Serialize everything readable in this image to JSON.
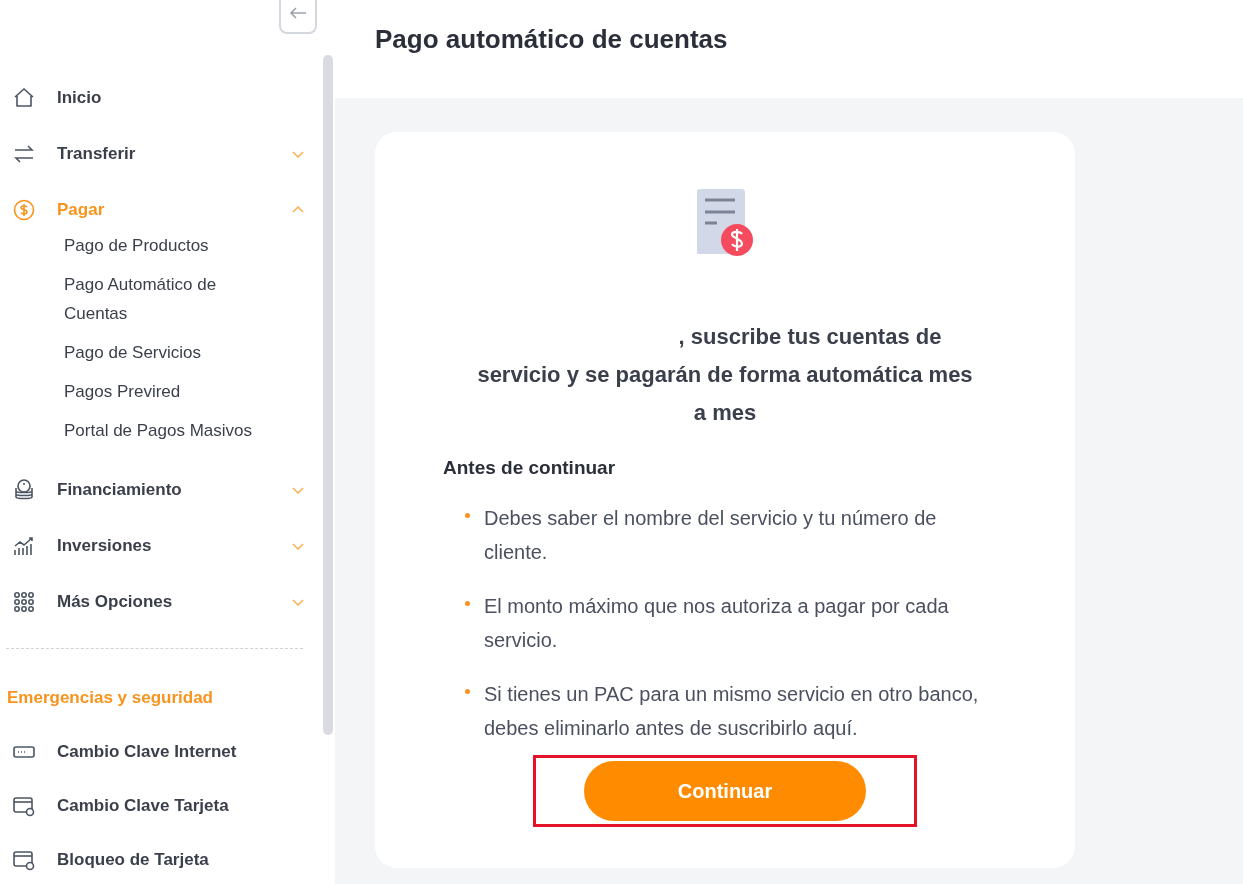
{
  "page": {
    "title": "Pago automático de cuentas"
  },
  "sidebar": {
    "items": [
      {
        "kind": "link",
        "label": "Inicio",
        "selected": false
      },
      {
        "kind": "group",
        "label": "Transferir",
        "expanded": false,
        "selected": false
      },
      {
        "kind": "group",
        "label": "Pagar",
        "expanded": true,
        "selected": true,
        "children": [
          {
            "label": "Pago de Productos"
          },
          {
            "label": "Pago Automático de Cuentas"
          },
          {
            "label": "Pago de Servicios"
          },
          {
            "label": "Pagos Previred"
          },
          {
            "label": "Portal de Pagos Masivos"
          }
        ]
      },
      {
        "kind": "group",
        "label": "Financiamiento",
        "expanded": false,
        "selected": false
      },
      {
        "kind": "group",
        "label": "Inversiones",
        "expanded": false,
        "selected": false
      },
      {
        "kind": "group",
        "label": "Más Opciones",
        "expanded": false,
        "selected": false
      }
    ],
    "section_title": "Emergencias y seguridad",
    "security_items": [
      {
        "label": "Cambio Clave Internet"
      },
      {
        "label": "Cambio Clave Tarjeta"
      },
      {
        "label": "Bloqueo de Tarjeta"
      }
    ]
  },
  "card": {
    "headline": ", suscribe tus cuentas de servicio y se pagarán de forma automática mes a mes",
    "subtitle": "Antes de continuar",
    "bullets": [
      "Debes saber el nombre del servicio y tu número de cliente.",
      "El monto máximo que nos autoriza a pagar por cada servicio.",
      "Si tienes un PAC para un mismo servicio en otro banco, debes eliminarlo antes de suscribirlo aquí."
    ],
    "button": {
      "label": "Continuar",
      "highlighted": true
    }
  }
}
